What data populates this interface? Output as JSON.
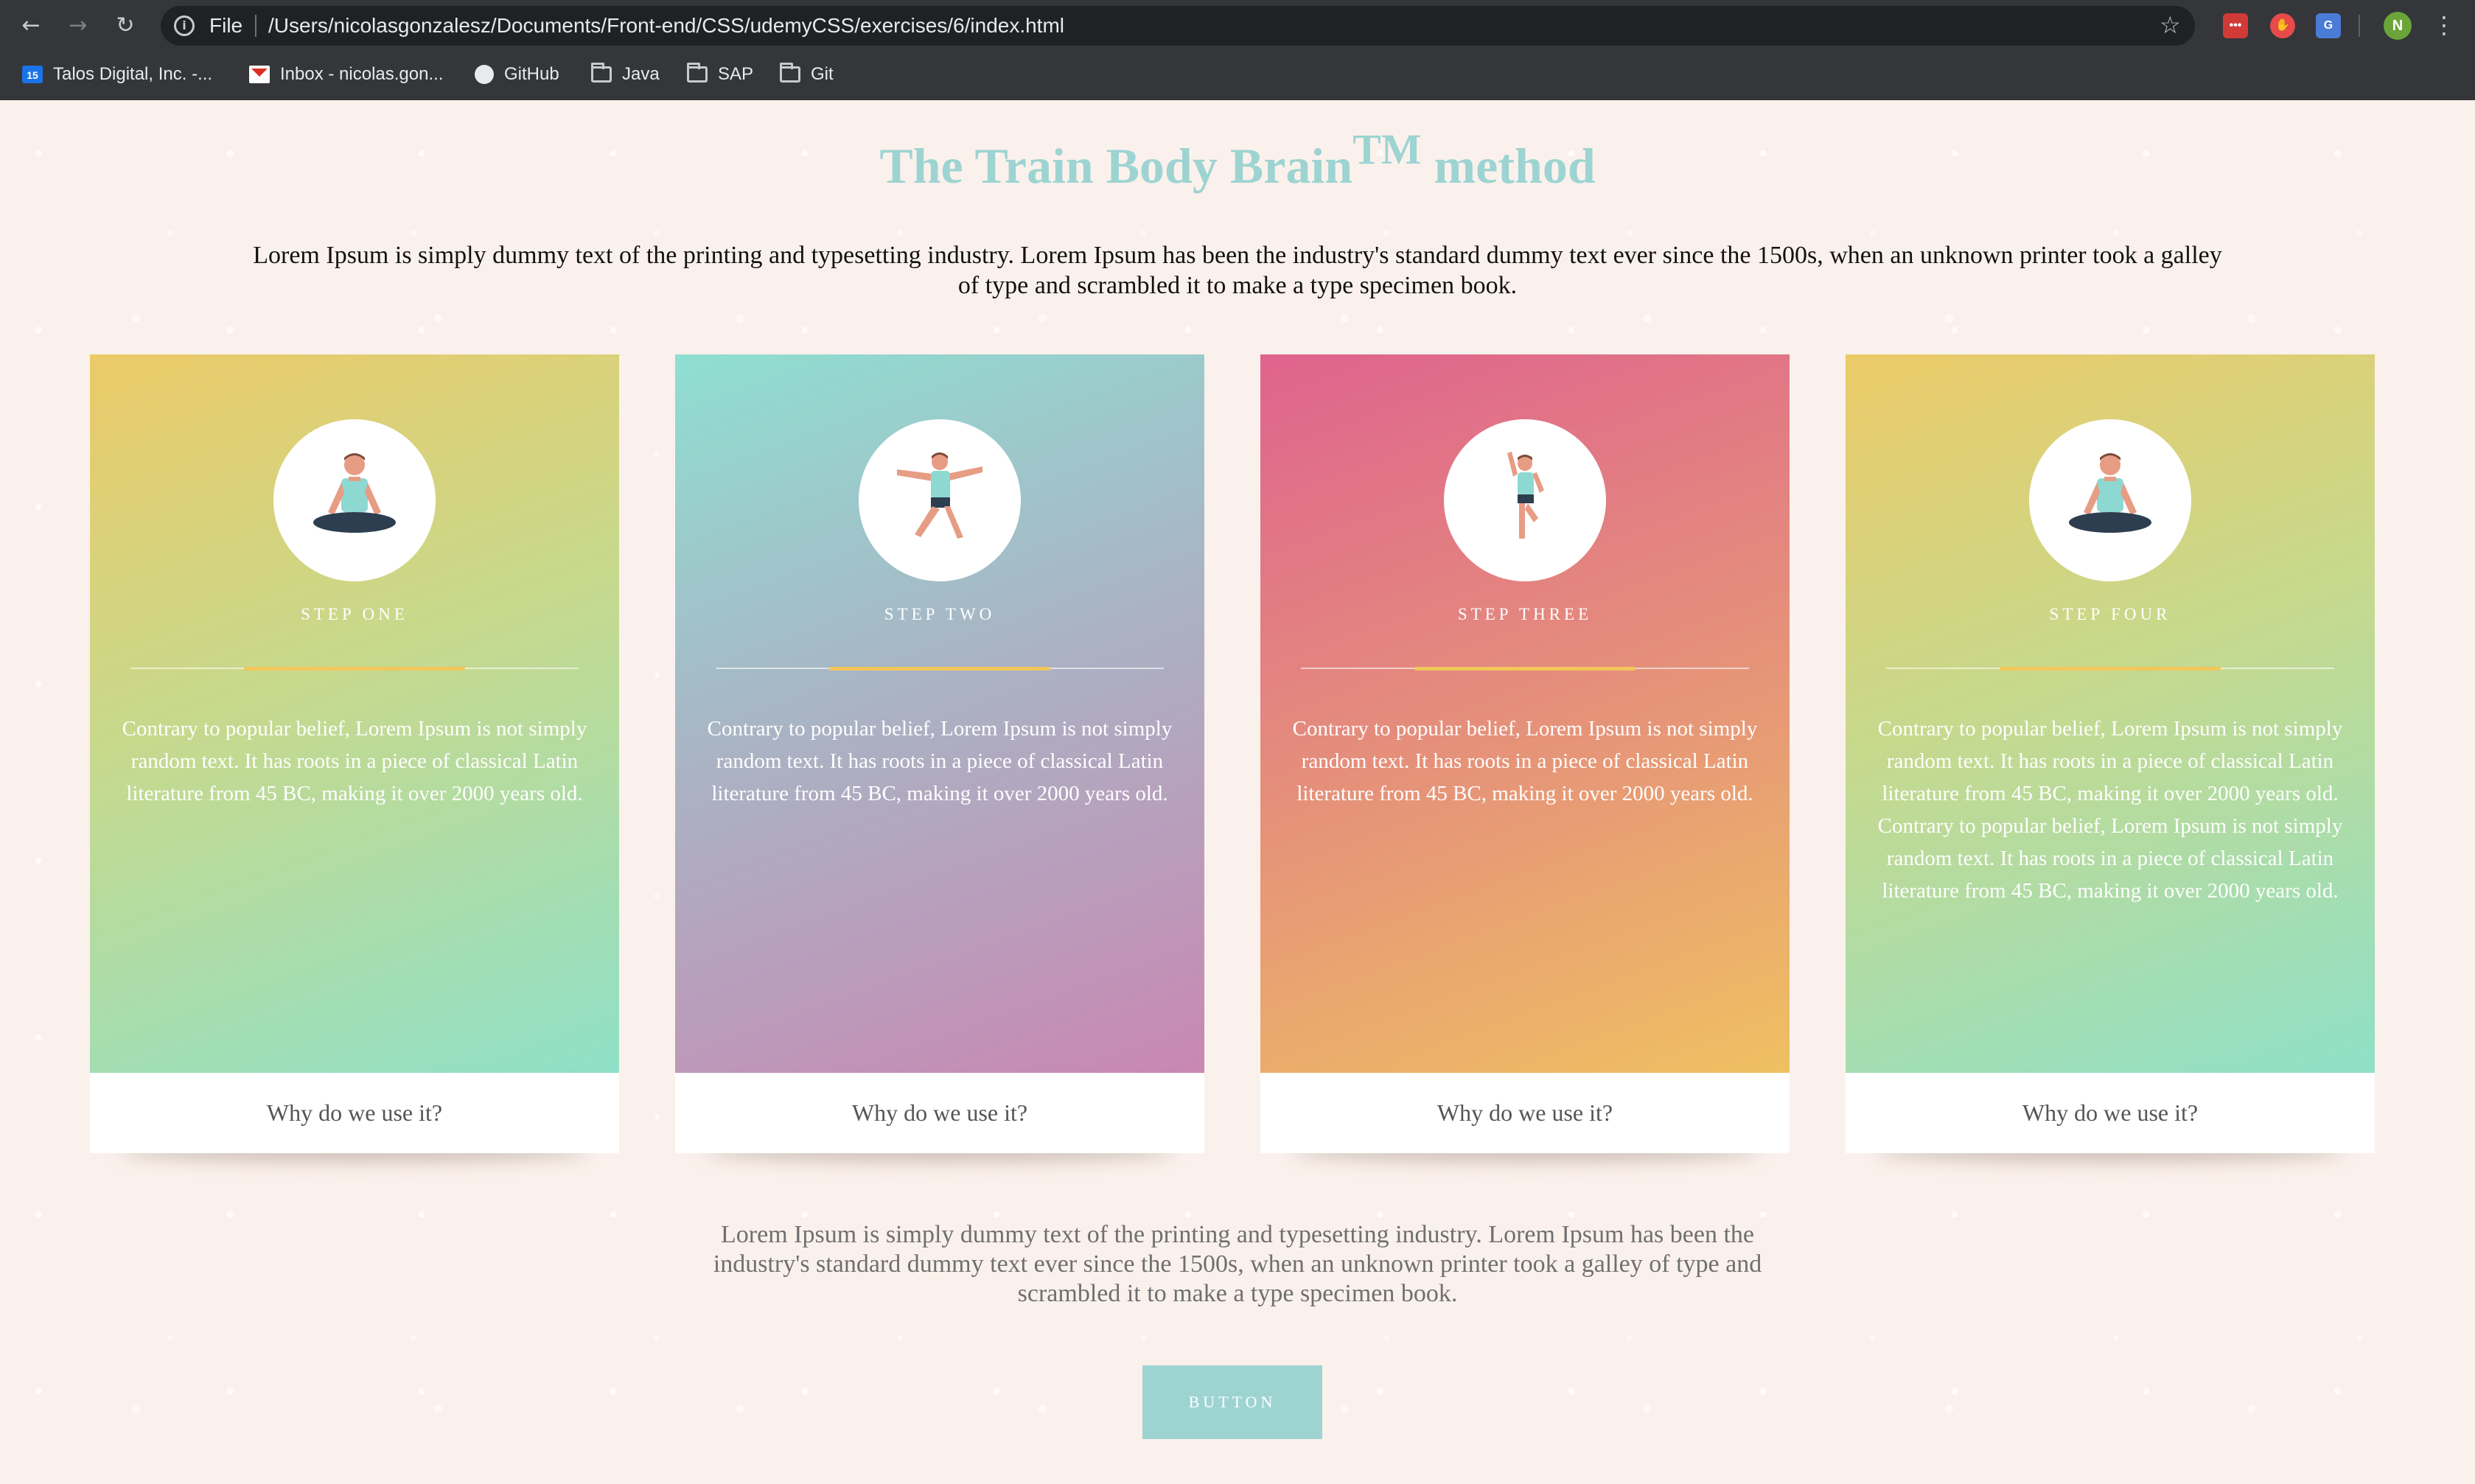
{
  "browser": {
    "scheme_label": "File",
    "url": "/Users/nicolasgonzalesz/Documents/Front-end/CSS/udemyCSS/exercises/6/index.html",
    "profile_initial": "N",
    "calendar_day": "15",
    "bookmarks": [
      {
        "label": "Talos Digital, Inc. -...",
        "icon": "calendar-icon"
      },
      {
        "label": "Inbox - nicolas.gon...",
        "icon": "gmail-icon"
      },
      {
        "label": "GitHub",
        "icon": "github-icon"
      },
      {
        "label": "Java",
        "icon": "folder-icon"
      },
      {
        "label": "SAP",
        "icon": "folder-icon"
      },
      {
        "label": "Git",
        "icon": "folder-icon"
      }
    ]
  },
  "page": {
    "title_before": "The Train Body Brain",
    "title_sup": "TM",
    "title_after": " method",
    "intro": "Lorem Ipsum is simply dummy text of the printing and typesetting industry. Lorem Ipsum has been the industry's standard dummy text ever since the 1500s, when an unknown printer took a galley of type and scrambled it to make a type specimen book.",
    "cards": [
      {
        "step": "STEP ONE",
        "text": "Contrary to popular belief, Lorem Ipsum is not simply random text. It has roots in a piece of classical Latin literature from 45 BC, making it over 2000 years old.",
        "footer": "Why do we use it?",
        "icon": "meditation-pose-icon"
      },
      {
        "step": "STEP TWO",
        "text": "Contrary to popular belief, Lorem Ipsum is not simply random text. It has roots in a piece of classical Latin literature from 45 BC, making it over 2000 years old.",
        "footer": "Why do we use it?",
        "icon": "stretch-pose-icon"
      },
      {
        "step": "STEP THREE",
        "text": "Contrary to popular belief, Lorem Ipsum is not simply random text. It has roots in a piece of classical Latin literature from 45 BC, making it over 2000 years old.",
        "footer": "Why do we use it?",
        "icon": "jump-pose-icon"
      },
      {
        "step": "STEP FOUR",
        "text": "Contrary to popular belief, Lorem Ipsum is not simply random text. It has roots in a piece of classical Latin literature from 45 BC, making it over 2000 years old. Contrary to popular belief, Lorem Ipsum is not simply random text. It has roots in a piece of classical Latin literature from 45 BC, making it over 2000 years old.",
        "footer": "Why do we use it?",
        "icon": "meditation-pose-icon"
      }
    ],
    "outro": "Lorem Ipsum is simply dummy text of the printing and typesetting industry. Lorem Ipsum has been the industry's standard dummy text ever since the 1500s, when an unknown printer took a galley of type and scrambled it to make a type specimen book.",
    "button_label": "BUTTON"
  },
  "colors": {
    "accent": "#9dd4d2",
    "page_bg": "#fbf1ec",
    "divider_accent": "#f2c65a"
  }
}
